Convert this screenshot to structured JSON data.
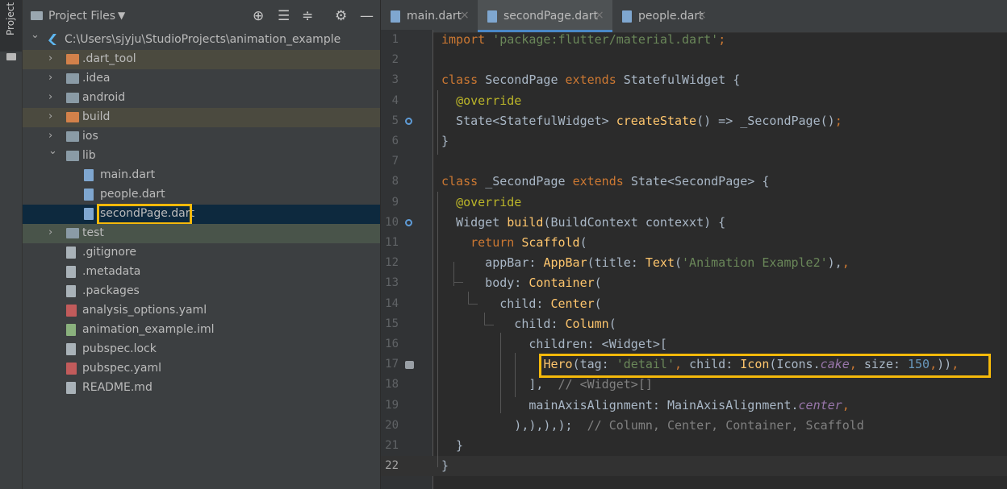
{
  "sidebar_stripe": {
    "label": "Project"
  },
  "project_panel": {
    "title": "Project Files",
    "toolbar": [
      "locate-icon",
      "expand-all-icon",
      "collapse-all-icon",
      "gear-icon",
      "minimize-icon"
    ],
    "tree": [
      {
        "label": "C:\\Users\\sjyju\\StudioProjects\\animation_example",
        "depth": 0,
        "arrow": "down",
        "icon": "flutter"
      },
      {
        "label": ".dart_tool",
        "depth": 1,
        "arrow": "right",
        "icon": "folder-orange",
        "bg": "#4b4a3f"
      },
      {
        "label": ".idea",
        "depth": 1,
        "arrow": "right",
        "icon": "folder"
      },
      {
        "label": "android",
        "depth": 1,
        "arrow": "right",
        "icon": "folder"
      },
      {
        "label": "build",
        "depth": 1,
        "arrow": "right",
        "icon": "folder-orange",
        "bg": "#4b4a3f"
      },
      {
        "label": "ios",
        "depth": 1,
        "arrow": "right",
        "icon": "folder"
      },
      {
        "label": "lib",
        "depth": 1,
        "arrow": "down",
        "icon": "folder"
      },
      {
        "label": "main.dart",
        "depth": 2,
        "arrow": "",
        "icon": "dart"
      },
      {
        "label": "people.dart",
        "depth": 2,
        "arrow": "",
        "icon": "dart"
      },
      {
        "label": "secondPage.dart",
        "depth": 2,
        "arrow": "",
        "icon": "dart",
        "bg": "#0d293e",
        "highlight": true
      },
      {
        "label": "test",
        "depth": 1,
        "arrow": "right",
        "icon": "folder",
        "bg": "#49544a"
      },
      {
        "label": ".gitignore",
        "depth": 1,
        "arrow": "",
        "icon": "file"
      },
      {
        "label": ".metadata",
        "depth": 1,
        "arrow": "",
        "icon": "file"
      },
      {
        "label": ".packages",
        "depth": 1,
        "arrow": "",
        "icon": "file"
      },
      {
        "label": "analysis_options.yaml",
        "depth": 1,
        "arrow": "",
        "icon": "yaml"
      },
      {
        "label": "animation_example.iml",
        "depth": 1,
        "arrow": "",
        "icon": "iml"
      },
      {
        "label": "pubspec.lock",
        "depth": 1,
        "arrow": "",
        "icon": "file"
      },
      {
        "label": "pubspec.yaml",
        "depth": 1,
        "arrow": "",
        "icon": "yaml"
      },
      {
        "label": "README.md",
        "depth": 1,
        "arrow": "",
        "icon": "file"
      }
    ]
  },
  "editor": {
    "tabs": [
      {
        "label": "main.dart",
        "active": false
      },
      {
        "label": "secondPage.dart",
        "active": true
      },
      {
        "label": "people.dart",
        "active": false
      }
    ],
    "close_glyph": "×",
    "current_line": 22,
    "lines": [
      {
        "n": "1",
        "t": [
          [
            "kw",
            "import "
          ],
          [
            "str",
            "'package:flutter/material.dart'"
          ],
          [
            "kw",
            ";"
          ]
        ]
      },
      {
        "n": "2",
        "t": []
      },
      {
        "n": "3",
        "t": [
          [
            "kw",
            "class "
          ],
          [
            "",
            "SecondPage "
          ],
          [
            "kw",
            "extends "
          ],
          [
            "",
            "StatefulWidget {"
          ]
        ]
      },
      {
        "n": "4",
        "t": [
          [
            "",
            "  "
          ],
          [
            "ann",
            "@override"
          ]
        ]
      },
      {
        "n": "5",
        "t": [
          [
            "",
            "  State<StatefulWidget> "
          ],
          [
            "fn",
            "createState"
          ],
          [
            "",
            "() => _SecondPage()"
          ],
          [
            "kw",
            ";"
          ]
        ],
        "g": "circle"
      },
      {
        "n": "6",
        "t": [
          [
            "",
            "}"
          ]
        ]
      },
      {
        "n": "7",
        "t": []
      },
      {
        "n": "8",
        "t": [
          [
            "kw",
            "class "
          ],
          [
            "",
            "_SecondPage "
          ],
          [
            "kw",
            "extends "
          ],
          [
            "",
            "State<SecondPage> {"
          ]
        ]
      },
      {
        "n": "9",
        "t": [
          [
            "",
            "  "
          ],
          [
            "ann",
            "@override"
          ]
        ]
      },
      {
        "n": "10",
        "t": [
          [
            "",
            "  Widget "
          ],
          [
            "fn",
            "build"
          ],
          [
            "",
            "(BuildContext contexxt) {"
          ]
        ],
        "g": "circle"
      },
      {
        "n": "11",
        "t": [
          [
            "",
            "    "
          ],
          [
            "kw",
            "return "
          ],
          [
            "fn",
            "Scaffold"
          ],
          [
            "",
            "("
          ]
        ]
      },
      {
        "n": "12",
        "t": [
          [
            "",
            "      appBar: "
          ],
          [
            "fn",
            "AppBar"
          ],
          [
            "",
            "(title: "
          ],
          [
            "fn",
            "Text"
          ],
          [
            "",
            "("
          ],
          [
            "str",
            "'Animation Example2'"
          ],
          [
            "",
            "),"
          ],
          [
            "kw",
            ","
          ]
        ]
      },
      {
        "n": "13",
        "t": [
          [
            "",
            "      body: "
          ],
          [
            "fn",
            "Container"
          ],
          [
            "",
            "("
          ]
        ]
      },
      {
        "n": "14",
        "t": [
          [
            "",
            "        child: "
          ],
          [
            "fn",
            "Center"
          ],
          [
            "",
            "("
          ]
        ]
      },
      {
        "n": "15",
        "t": [
          [
            "",
            "          child: "
          ],
          [
            "fn",
            "Column"
          ],
          [
            "",
            "("
          ]
        ]
      },
      {
        "n": "16",
        "t": [
          [
            "",
            "            children: <Widget>["
          ]
        ]
      },
      {
        "n": "17",
        "t": [
          [
            "",
            "              "
          ],
          [
            "fn",
            "Hero"
          ],
          [
            "",
            "(tag: "
          ],
          [
            "str",
            "'detail'"
          ],
          [
            "kw",
            ", "
          ],
          [
            "",
            "child: "
          ],
          [
            "fn",
            "Icon"
          ],
          [
            "",
            "(Icons."
          ],
          [
            "fld",
            "cake"
          ],
          [
            "kw",
            ", "
          ],
          [
            "",
            "size: "
          ],
          [
            "num",
            "150"
          ],
          [
            "kw",
            ","
          ],
          [
            "",
            "))"
          ],
          [
            "kw",
            ","
          ]
        ],
        "g": "robot",
        "highlight": true
      },
      {
        "n": "18",
        "t": [
          [
            "",
            "            ],  "
          ],
          [
            "cmt",
            "// <Widget>[]"
          ]
        ]
      },
      {
        "n": "19",
        "t": [
          [
            "",
            "            mainAxisAlignment: MainAxisAlignment."
          ],
          [
            "fld",
            "center"
          ],
          [
            "kw",
            ","
          ]
        ]
      },
      {
        "n": "20",
        "t": [
          [
            "",
            "          ),),),);  "
          ],
          [
            "cmt",
            "// Column, Center, Container, Scaffold"
          ]
        ]
      },
      {
        "n": "21",
        "t": [
          [
            "",
            "  }"
          ]
        ]
      },
      {
        "n": "22",
        "t": [
          [
            "",
            "}"
          ]
        ]
      }
    ]
  }
}
